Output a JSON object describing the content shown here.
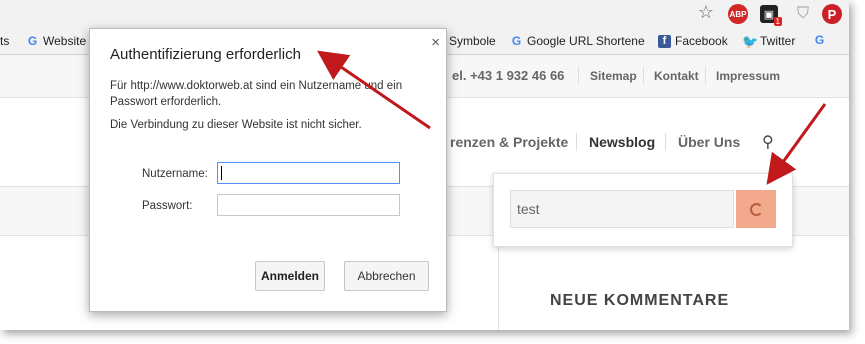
{
  "bookmarks": [
    {
      "label": "ts",
      "icon": "none"
    },
    {
      "label": "Website",
      "icon": "google-icon"
    },
    {
      "label": "Symbole",
      "icon": "none"
    },
    {
      "label": "Google URL Shortene",
      "icon": "google-icon"
    },
    {
      "label": "Facebook",
      "icon": "facebook-icon"
    },
    {
      "label": "Twitter",
      "icon": "twitter-icon"
    },
    {
      "label": "",
      "icon": "google-icon"
    }
  ],
  "toolbar": {
    "abp_label": "ABP",
    "ext_badge": "1",
    "pinterest_label": "P"
  },
  "site": {
    "phone": "el. +43 1 932 46 66",
    "links": [
      "Sitemap",
      "Kontakt",
      "Impressum"
    ],
    "nav": [
      "renzen & Projekte",
      "Newsblog",
      "Über Uns"
    ],
    "search_value": "test",
    "sidebar_heading": "NEUE KOMMENTARE"
  },
  "dialog": {
    "title": "Authentifizierung erforderlich",
    "close": "×",
    "message": "Für http://www.doktorweb.at sind ein Nutzername und ein Passwort erforderlich.",
    "warning": "Die Verbindung zu dieser Website ist nicht sicher.",
    "username_label": "Nutzername:",
    "password_label": "Passwort:",
    "username_value": "",
    "password_value": "",
    "login_button": "Anmelden",
    "cancel_button": "Abbrechen"
  },
  "colors": {
    "arrow": "#c0181b",
    "search_button": "#f3a98e"
  }
}
